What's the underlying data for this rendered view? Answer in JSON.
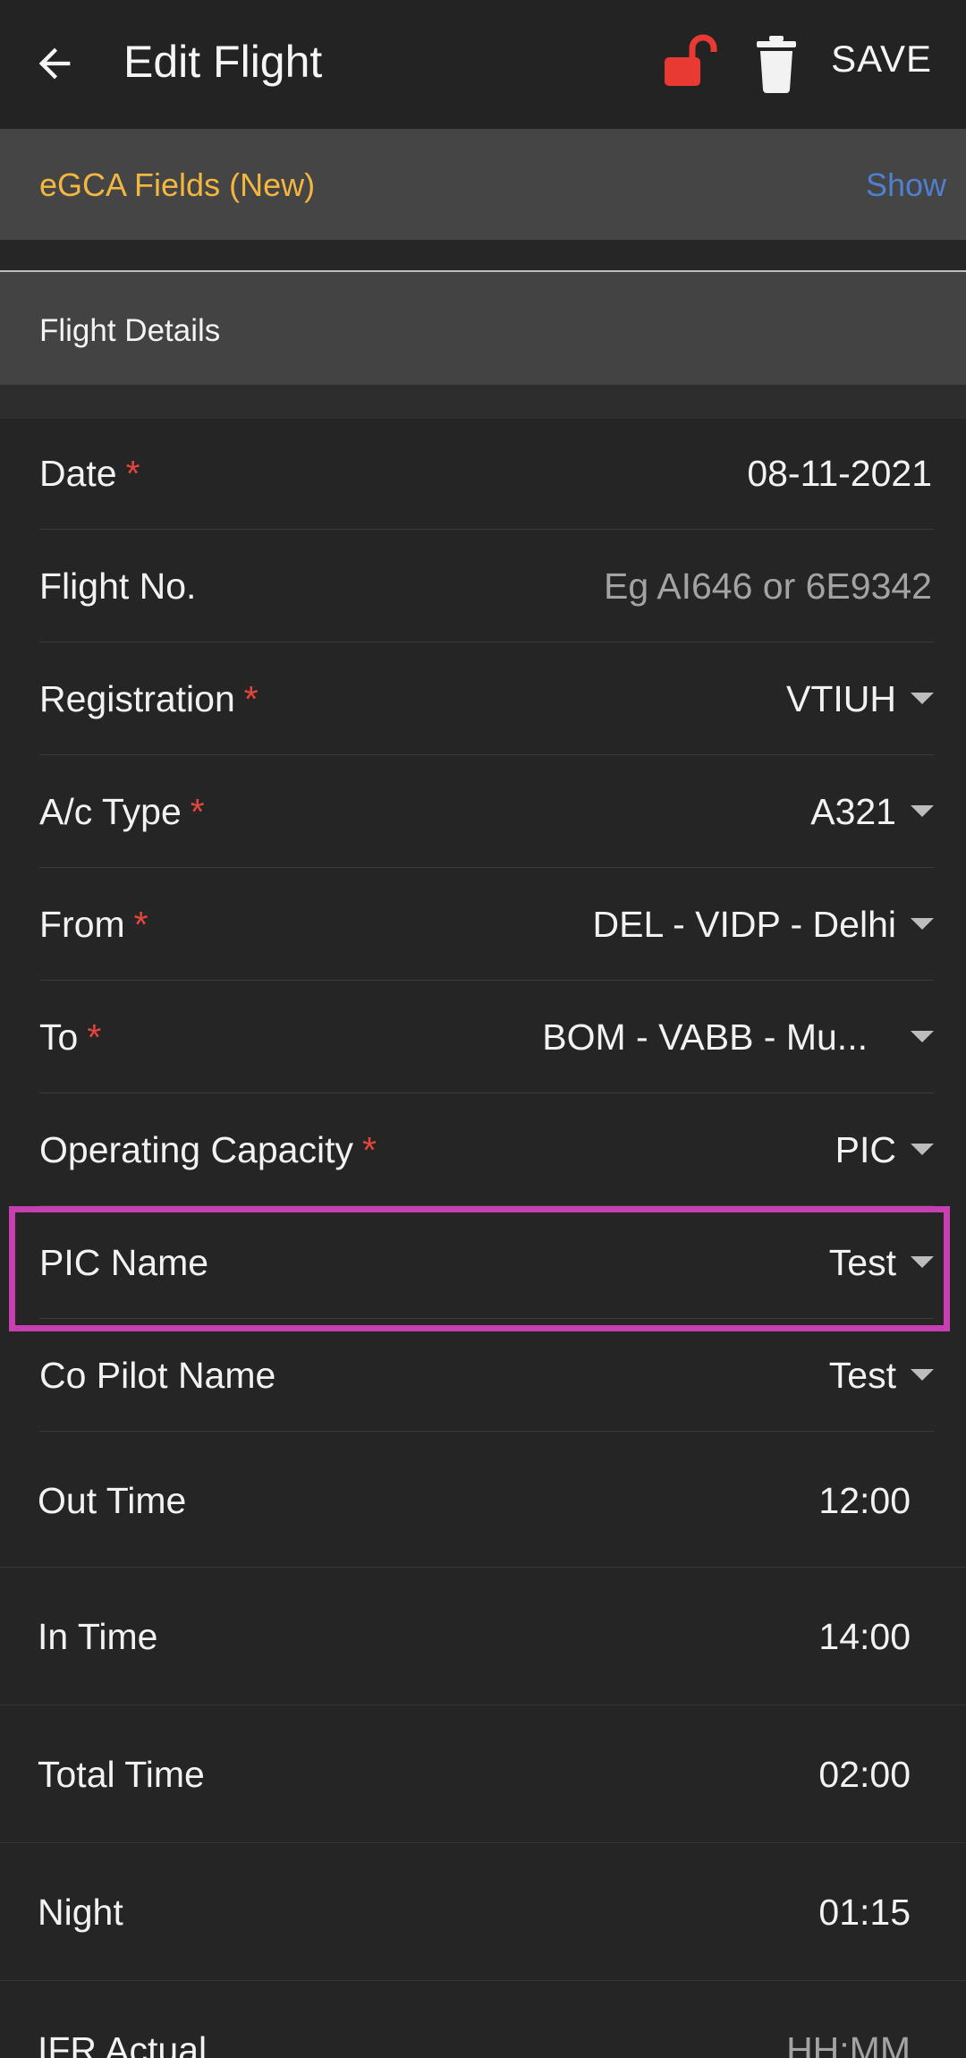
{
  "appbar": {
    "title": "Edit Flight",
    "save_label": "SAVE",
    "icons": [
      "arrow-left-icon",
      "lock-open-icon",
      "trash-icon"
    ],
    "lock_color": "#e83a33"
  },
  "egca": {
    "title": "eGCA Fields (New)",
    "action": "Show"
  },
  "section": {
    "title": "Flight Details"
  },
  "fields": [
    {
      "label": "Date",
      "required": true,
      "value": "08-11-2021"
    },
    {
      "label": "Flight No.",
      "required": false,
      "placeholder": "Eg AI646 or 6E9342"
    },
    {
      "label": "Registration",
      "required": true,
      "value": "VTIUH"
    },
    {
      "label": "A/c Type",
      "required": true,
      "value": "A321"
    },
    {
      "label": "From",
      "required": true,
      "value": "DEL - VIDP - Delhi"
    },
    {
      "label": "To",
      "required": true,
      "value": "BOM - VABB - Mu..."
    },
    {
      "label": "Operating Capacity",
      "required": true,
      "value": "PIC"
    },
    {
      "label": "PIC Name",
      "required": false,
      "value": "Test"
    },
    {
      "label": "Co Pilot Name",
      "required": false,
      "value": "Test"
    },
    {
      "label": "Out Time",
      "value": "12:00"
    },
    {
      "label": "In Time",
      "value": "14:00"
    },
    {
      "label": "Total Time",
      "value": "02:00"
    },
    {
      "label": "Night",
      "value": "01:15"
    },
    {
      "label": "IFR Actual",
      "placeholder": "HH:MM"
    }
  ],
  "required_mark": "*",
  "colors": {
    "background": "#252525",
    "accent_orange": "#f3b63f",
    "link_blue": "#4f7fcf",
    "required_red": "#e2453c",
    "highlight": "#c53fb0"
  }
}
